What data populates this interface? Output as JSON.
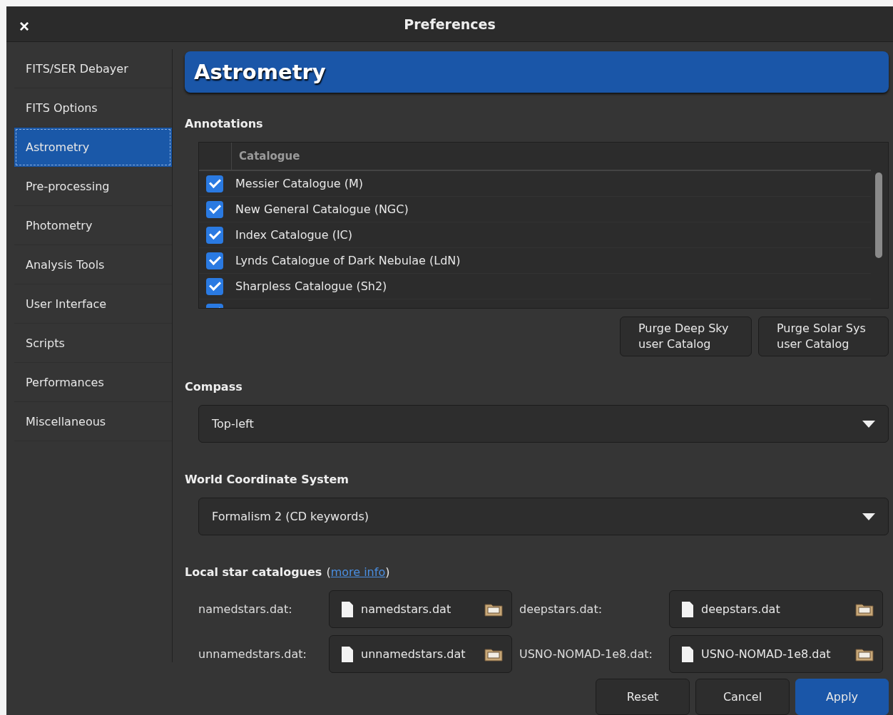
{
  "window": {
    "title": "Preferences",
    "close": "×"
  },
  "sidebar": {
    "items": [
      {
        "label": "FITS/SER Debayer",
        "selected": false
      },
      {
        "label": "FITS Options",
        "selected": false
      },
      {
        "label": "Astrometry",
        "selected": true
      },
      {
        "label": "Pre-processing",
        "selected": false
      },
      {
        "label": "Photometry",
        "selected": false
      },
      {
        "label": "Analysis Tools",
        "selected": false
      },
      {
        "label": "User Interface",
        "selected": false
      },
      {
        "label": "Scripts",
        "selected": false
      },
      {
        "label": "Performances",
        "selected": false
      },
      {
        "label": "Miscellaneous",
        "selected": false
      }
    ]
  },
  "page_title": "Astrometry",
  "annotations": {
    "heading": "Annotations",
    "column": "Catalogue",
    "rows": [
      {
        "name": "Messier Catalogue (M)",
        "checked": true
      },
      {
        "name": "New General Catalogue (NGC)",
        "checked": true
      },
      {
        "name": "Index Catalogue (IC)",
        "checked": true
      },
      {
        "name": "Lynds Catalogue of Dark Nebulae (LdN)",
        "checked": true
      },
      {
        "name": "Sharpless Catalogue (Sh2)",
        "checked": true
      },
      {
        "checked": true
      }
    ],
    "buttons": [
      "Purge Deep Sky\nuser Catalog",
      "Purge Solar Sys\nuser Catalog"
    ]
  },
  "compass": {
    "heading": "Compass",
    "value": "Top-left"
  },
  "wcs": {
    "heading": "World Coordinate System",
    "value": "Formalism 2 (CD keywords)"
  },
  "local": {
    "heading": "Local star catalogues",
    "paren_open": "(",
    "link": "more info",
    "paren_close": ")",
    "files": [
      {
        "label": "namedstars.dat:",
        "value": "namedstars.dat"
      },
      {
        "label": "deepstars.dat:",
        "value": "deepstars.dat"
      },
      {
        "label": "unnamedstars.dat:",
        "value": "unnamedstars.dat"
      },
      {
        "label": "USNO-NOMAD-1e8.dat:",
        "value": "USNO-NOMAD-1e8.dat"
      }
    ]
  },
  "footer": [
    {
      "label": "Reset",
      "kind": "normal"
    },
    {
      "label": "Cancel",
      "kind": "normal"
    },
    {
      "label": "Apply",
      "kind": "primary"
    }
  ]
}
